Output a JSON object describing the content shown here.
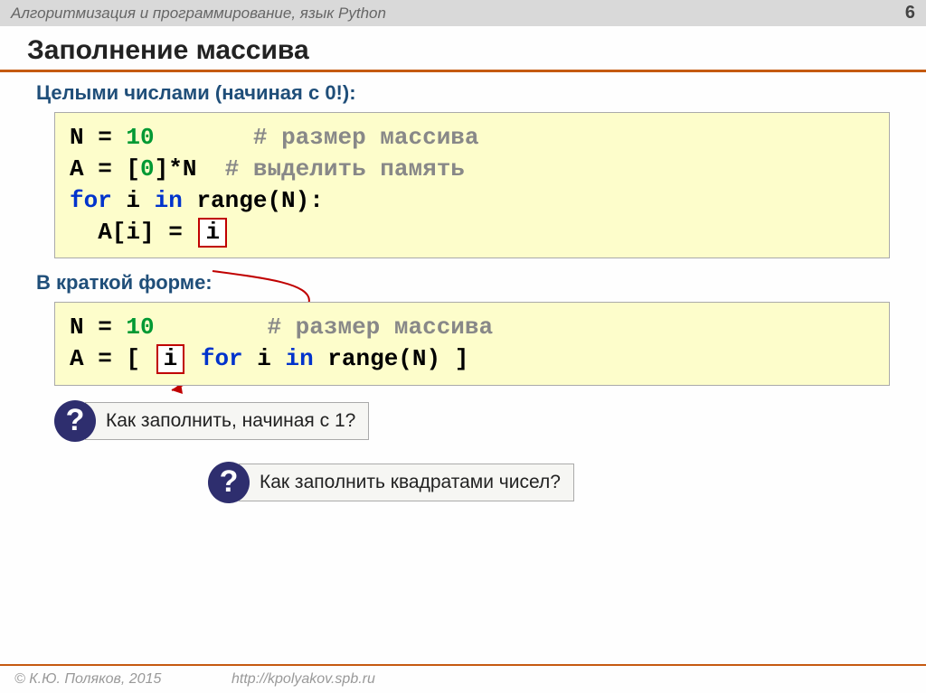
{
  "header": {
    "title": "Алгоритмизация и программирование, язык Python",
    "page": "6"
  },
  "title": "Заполнение массива",
  "sub1": "Целыми числами (начиная с 0!):",
  "sub2": "В краткой форме:",
  "code1": {
    "l1a": "N = ",
    "l1n": "10",
    "l1c": "# размер массива",
    "l2a": "A = [",
    "l2n": "0",
    "l2b": "]*N",
    "l2c": "# выделить память",
    "l3a": "for",
    "l3b": " i ",
    "l3c": "in",
    "l3d": " range(N):",
    "l4a": "  A[i] = ",
    "l4box": "i"
  },
  "code2": {
    "l1a": "N = ",
    "l1n": "10",
    "l1c": "# размер массива",
    "l2a": "A = [ ",
    "l2box": "i",
    "l2b": "for",
    "l2c": " i ",
    "l2d": "in",
    "l2e": " range(N) ]"
  },
  "q1": {
    "mark": "?",
    "text": "Как заполнить, начиная с 1?"
  },
  "q2": {
    "mark": "?",
    "text": "Как заполнить квадратами чисел?"
  },
  "footer": {
    "copy": "© К.Ю. Поляков, 2015",
    "url": "http://kpolyakov.spb.ru"
  }
}
